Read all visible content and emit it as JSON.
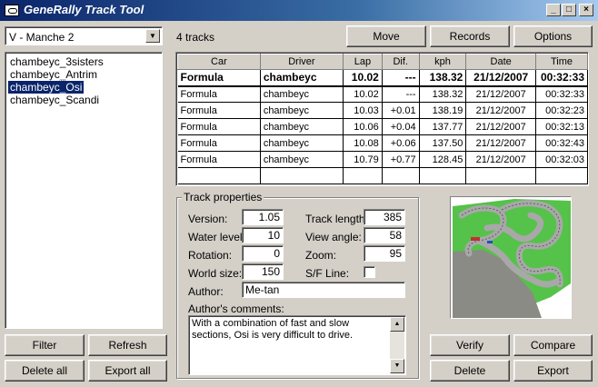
{
  "window": {
    "title": "GeneRally Track Tool",
    "controls": {
      "minimize": "_",
      "maximize": "□",
      "close": "×"
    }
  },
  "track_selector": {
    "selected": "V - Manche 2",
    "arrow": "▼"
  },
  "tracks_count": "4 tracks",
  "toolbar": {
    "move": "Move",
    "records": "Records",
    "options": "Options"
  },
  "track_list": [
    "chambeyc_3sisters",
    "chambeyc_Antrim",
    "chambeyc_Osi",
    "chambeyc_Scandi"
  ],
  "selected_track_index": 2,
  "table": {
    "headers": [
      "Car",
      "Driver",
      "Lap",
      "Dif.",
      "kph",
      "Date",
      "Time"
    ],
    "best": [
      "Formula",
      "chambeyc",
      "10.02",
      "---",
      "138.32",
      "21/12/2007",
      "00:32:33"
    ],
    "rows": [
      [
        "Formula",
        "chambeyc",
        "10.02",
        "---",
        "138.32",
        "21/12/2007",
        "00:32:33"
      ],
      [
        "Formula",
        "chambeyc",
        "10.03",
        "+0.01",
        "138.19",
        "21/12/2007",
        "00:32:23"
      ],
      [
        "Formula",
        "chambeyc",
        "10.06",
        "+0.04",
        "137.77",
        "21/12/2007",
        "00:32:13"
      ],
      [
        "Formula",
        "chambeyc",
        "10.08",
        "+0.06",
        "137.50",
        "21/12/2007",
        "00:32:43"
      ],
      [
        "Formula",
        "chambeyc",
        "10.79",
        "+0.77",
        "128.45",
        "21/12/2007",
        "00:32:03"
      ]
    ]
  },
  "properties": {
    "title": "Track properties",
    "version_label": "Version:",
    "version": "1.05",
    "water_label": "Water level:",
    "water": "10",
    "rotation_label": "Rotation:",
    "rotation": "0",
    "world_label": "World size:",
    "world": "150",
    "length_label": "Track length:",
    "length": "385",
    "view_label": "View angle:",
    "view": "58",
    "zoom_label": "Zoom:",
    "zoom": "95",
    "sf_label": "S/F Line:",
    "sf_checked": false,
    "author_label": "Author:",
    "author": "Me-tan",
    "comments_label": "Author's comments:",
    "comments": "With a combination of fast and slow sections, Osi is very difficult to drive."
  },
  "buttons": {
    "filter": "Filter",
    "refresh": "Refresh",
    "delete_all": "Delete all",
    "export_all": "Export all",
    "verify": "Verify",
    "compare": "Compare",
    "delete": "Delete",
    "export": "Export"
  },
  "colors": {
    "selection": "#0a246a",
    "face": "#d4d0c8",
    "grass": "#5bc84b",
    "track": "#9a9a9a"
  }
}
